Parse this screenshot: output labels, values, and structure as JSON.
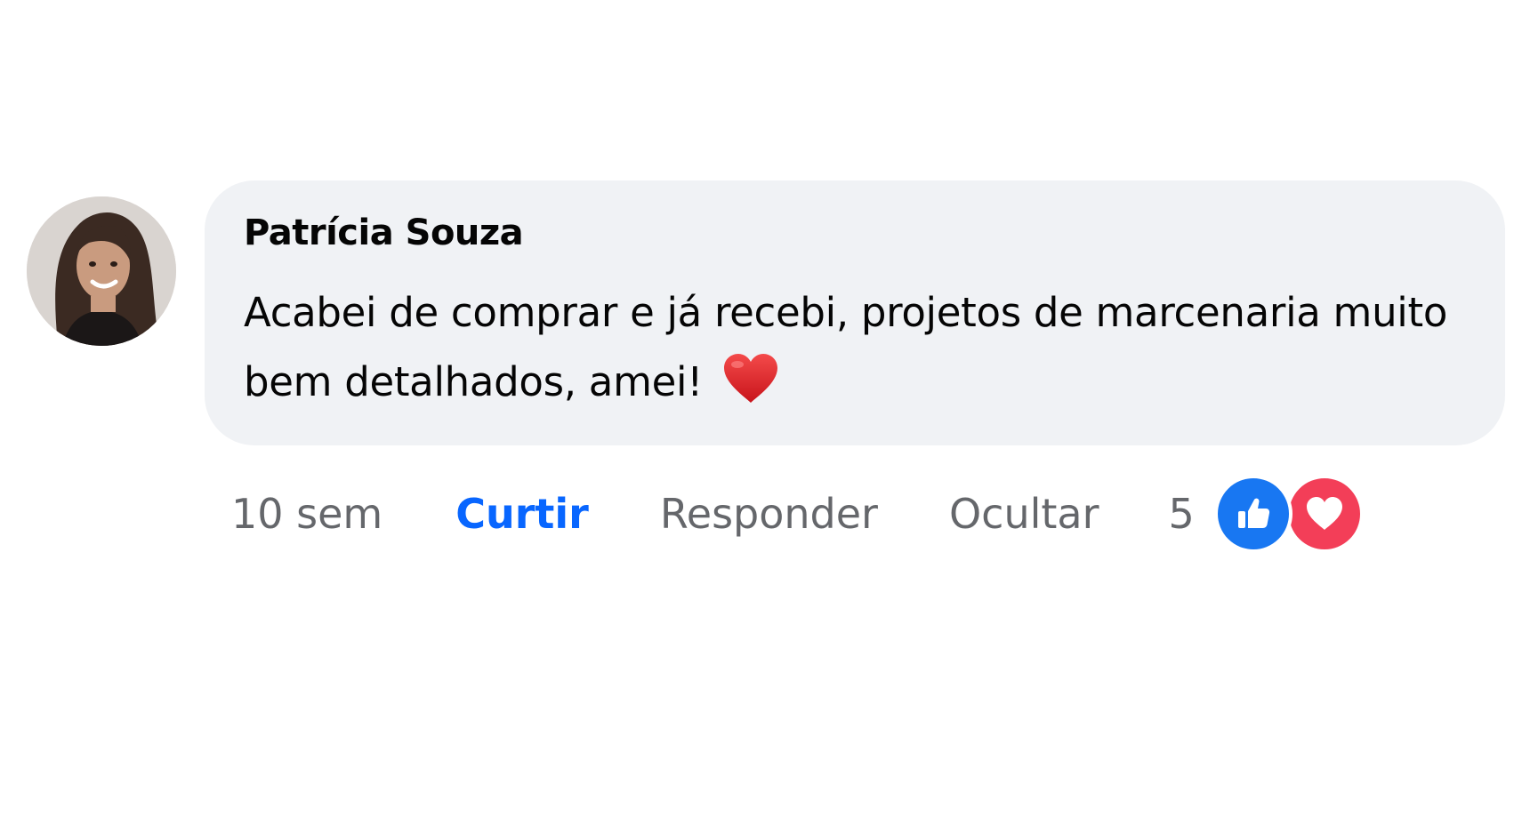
{
  "comment": {
    "author": "Patrícia Souza",
    "text": "Acabei de comprar e já recebi, projetos de marcenaria muito bem detalhados, amei!",
    "emoji": "heart-emoji"
  },
  "actions": {
    "timestamp": "10 sem",
    "like_label": "Curtir",
    "reply_label": "Responder",
    "hide_label": "Ocultar",
    "reaction_count": "5",
    "reaction_types": [
      "like",
      "love"
    ]
  },
  "colors": {
    "bubble_bg": "#f0f2f5",
    "like_active": "#0866ff",
    "like_reaction": "#1877f2",
    "love_reaction": "#f33e58",
    "secondary_text": "#65676b"
  }
}
